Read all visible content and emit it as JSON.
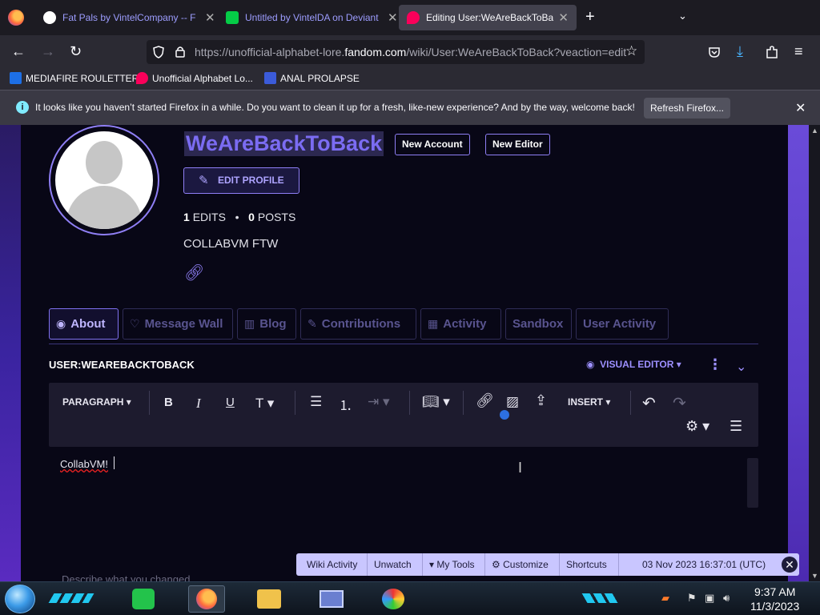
{
  "browser": {
    "tabs": [
      {
        "title": "Fat Pals by VintelCompany -- F",
        "favicon_color": "#ffffff",
        "active": false
      },
      {
        "title": "Untitled by VintelDA on Deviant",
        "favicon_color": "#05cc47",
        "active": false
      },
      {
        "title": "Editing User:WeAreBackToBack",
        "favicon_color": "#fa005a",
        "active": true
      }
    ],
    "url": {
      "prefix": "https://unofficial-alphabet-lore.",
      "domain": "fandom.com",
      "suffix": "/wiki/User:WeAreBackToBack?veaction=edit"
    },
    "bookmarks": [
      {
        "label": "MEDIAFIRE ROULETTER",
        "favicon_color": "#1d6fe6"
      },
      {
        "label": "Unofficial Alphabet Lo...",
        "favicon_color": "#fa005a"
      },
      {
        "label": "ANAL PROLAPSE",
        "favicon_color": "#3b5bd9"
      }
    ]
  },
  "notification": {
    "message": "It looks like you haven’t started Firefox in a while. Do you want to clean it up for a fresh, like-new experience? And by the way, welcome back!",
    "button_label": "Refresh Firefox..."
  },
  "profile": {
    "username": "WeAreBackToBack",
    "tags": [
      "New Account",
      "New Editor"
    ],
    "edit_profile_label": "EDIT PROFILE",
    "edits_count": "1",
    "edits_label": "EDITS",
    "posts_count": "0",
    "posts_label": "POSTS",
    "bio": "COLLABVM FTW",
    "tabs": [
      {
        "label": "About",
        "active": true
      },
      {
        "label": "Message Wall",
        "active": false
      },
      {
        "label": "Blog",
        "active": false
      },
      {
        "label": "Contributions",
        "active": false
      },
      {
        "label": "Activity",
        "active": false
      },
      {
        "label": "Sandbox",
        "active": false
      },
      {
        "label": "User Activity",
        "active": false
      }
    ]
  },
  "editor": {
    "page_name": "USER:WEAREBACKTOBACK",
    "mode_label": "VISUAL EDITOR",
    "toolbar": {
      "paragraph_label": "PARAGRAPH",
      "insert_label": "INSERT"
    },
    "content": "CollabVM!",
    "summary_placeholder": "Describe what you changed"
  },
  "fandom_bar": {
    "items": [
      "Wiki Activity",
      "Unwatch",
      "My Tools",
      "Customize",
      "Shortcuts"
    ],
    "timestamp": "03 Nov 2023 16:37:01 (UTC)"
  },
  "taskbar": {
    "time": "9:37 AM",
    "date": "11/3/2023"
  },
  "colors": {
    "accent": "#8f7ff5",
    "page_bg": "#080716",
    "fandom_bar_bg": "#c9c6ff"
  }
}
